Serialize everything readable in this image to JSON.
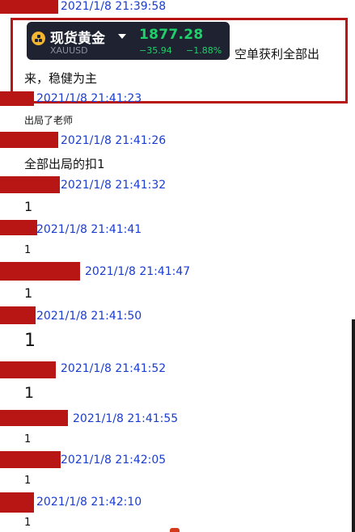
{
  "colors": {
    "redaction": "#b81515",
    "timestamp": "#1a3ccf",
    "highlight_border": "#b81515",
    "quote_bg": "#1f2331",
    "quote_up": "#1fcf6a",
    "gold_icon": "#f2b630"
  },
  "quote": {
    "name": "现货黄金",
    "symbol": "XAUUSD",
    "price": "1877.28",
    "change": "−35.94",
    "change_pct": "−1.88%",
    "icon": "gold-coin-icon",
    "dropdown_icon": "caret-down-icon"
  },
  "messages": [
    {
      "time": "2021/1/8 21:39:58",
      "text": ""
    },
    {
      "time": "",
      "text_after_card": "空单获利全部出",
      "text_line2": "来，稳健为主"
    },
    {
      "time": "2021/1/8 21:41:23",
      "text": "出局了老师"
    },
    {
      "time": "2021/1/8 21:41:26",
      "text": "全部出局的扣1"
    },
    {
      "time": "2021/1/8 21:41:32",
      "text": "1"
    },
    {
      "time": "2021/1/8 21:41:41",
      "text": "1"
    },
    {
      "time": "2021/1/8 21:41:47",
      "text": "1"
    },
    {
      "time": "2021/1/8 21:41:50",
      "text": "1"
    },
    {
      "time": "2021/1/8 21:41:52",
      "text": "1"
    },
    {
      "time": "2021/1/8 21:41:55",
      "text": "1"
    },
    {
      "time": "2021/1/8 21:42:05",
      "text": "1"
    },
    {
      "time": "2021/1/8 21:42:10",
      "text": "1"
    }
  ]
}
